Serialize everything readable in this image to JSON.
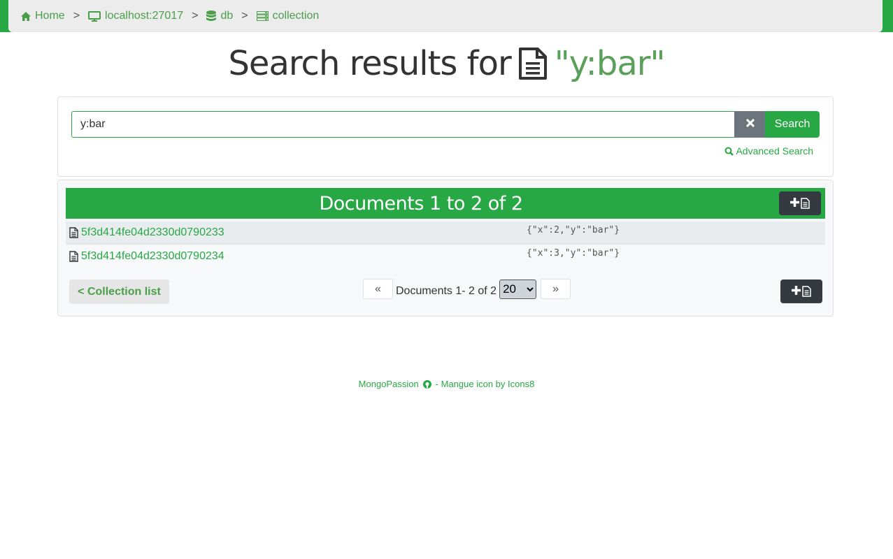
{
  "breadcrumb": {
    "items": [
      {
        "label": "Home",
        "icon": "home-icon"
      },
      {
        "label": "localhost:27017",
        "icon": "monitor-icon"
      },
      {
        "label": "db",
        "icon": "database-icon"
      },
      {
        "label": "collection",
        "icon": "server-icon"
      }
    ],
    "separator": ">"
  },
  "title": {
    "prefix": "Search results for",
    "query": "\"y:bar\""
  },
  "search": {
    "value": "y:bar",
    "button_label": "Search",
    "advanced_label": "Advanced Search"
  },
  "results": {
    "heading": "Documents 1 to 2 of 2",
    "documents": [
      {
        "id": "5f3d414fe04d2330d0790233",
        "json": "{\"x\":2,\"y\":\"bar\"}"
      },
      {
        "id": "5f3d414fe04d2330d0790234",
        "json": "{\"x\":3,\"y\":\"bar\"}"
      }
    ],
    "collection_list_label": "< Collection list",
    "pager": {
      "prev": "«",
      "next": "»",
      "text": "Documents 1- 2 of 2",
      "page_size": "20"
    }
  },
  "footer": {
    "brand": "MongoPassion",
    "credit": "- Mangue icon by Icons8"
  },
  "colors": {
    "accent": "#28a745",
    "dark_button": "#343a40",
    "secondary": "#6c757d"
  }
}
